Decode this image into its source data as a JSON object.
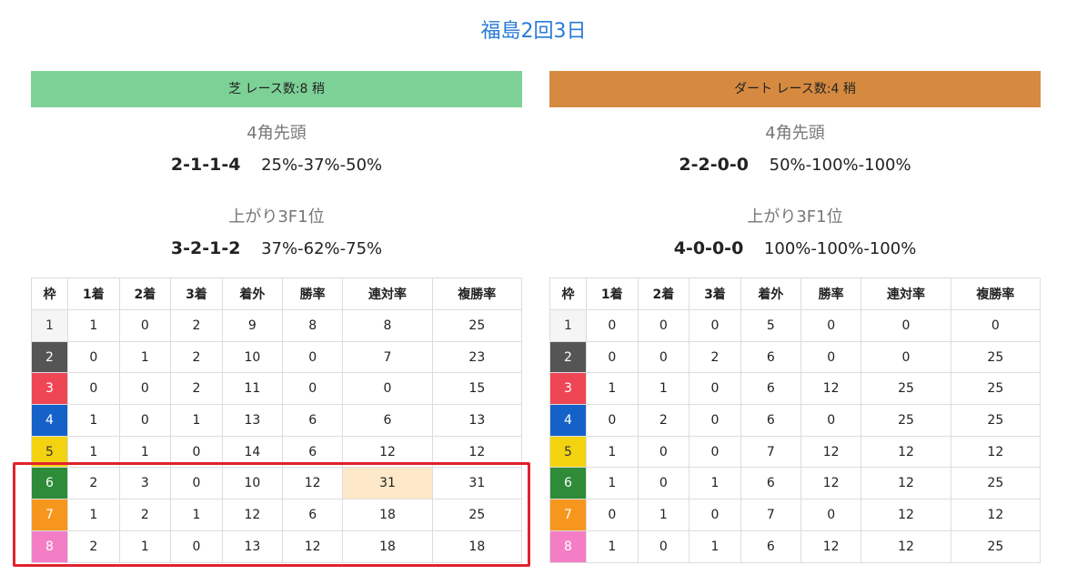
{
  "title": "福島2回3日",
  "colors": {
    "turf_header": "#7dd197",
    "dirt_header": "#d68a40",
    "highlight_cell": "#fde9c9",
    "highlight_box": "#e0232d",
    "frames": [
      "#f5f5f5",
      "#555555",
      "#ef4655",
      "#1462c8",
      "#f3d30f",
      "#2e8b38",
      "#f7961d",
      "#f47ec6"
    ],
    "frame_text": [
      "#333333",
      "#ffffff",
      "#ffffff",
      "#ffffff",
      "#333333",
      "#ffffff",
      "#ffffff",
      "#ffffff"
    ]
  },
  "panels": [
    {
      "header": "芝 レース数:8  稍",
      "corner_label": "4角先頭",
      "corner_big": [
        "2",
        "1",
        "1",
        "4"
      ],
      "corner_pct": "25%-37%-50%",
      "agari_label": "上がり3F1位",
      "agari_big": [
        "3",
        "2",
        "1",
        "2"
      ],
      "agari_pct": "37%-62%-75%",
      "columns": [
        "枠",
        "1着",
        "2着",
        "3着",
        "着外",
        "勝率",
        "連対率",
        "複勝率"
      ],
      "rows": [
        [
          "1",
          "1",
          "0",
          "2",
          "9",
          "8",
          "8",
          "25"
        ],
        [
          "2",
          "0",
          "1",
          "2",
          "10",
          "0",
          "7",
          "23"
        ],
        [
          "3",
          "0",
          "0",
          "2",
          "11",
          "0",
          "0",
          "15"
        ],
        [
          "4",
          "1",
          "0",
          "1",
          "13",
          "6",
          "6",
          "13"
        ],
        [
          "5",
          "1",
          "1",
          "0",
          "14",
          "6",
          "12",
          "12"
        ],
        [
          "6",
          "2",
          "3",
          "0",
          "10",
          "12",
          "31",
          "31"
        ],
        [
          "7",
          "1",
          "2",
          "1",
          "12",
          "6",
          "18",
          "25"
        ],
        [
          "8",
          "2",
          "1",
          "0",
          "13",
          "12",
          "18",
          "18"
        ]
      ]
    },
    {
      "header": "ダート レース数:4  稍",
      "corner_label": "4角先頭",
      "corner_big": [
        "2",
        "2",
        "0",
        "0"
      ],
      "corner_pct": "50%-100%-100%",
      "agari_label": "上がり3F1位",
      "agari_big": [
        "4",
        "0",
        "0",
        "0"
      ],
      "agari_pct": "100%-100%-100%",
      "columns": [
        "枠",
        "1着",
        "2着",
        "3着",
        "着外",
        "勝率",
        "連対率",
        "複勝率"
      ],
      "rows": [
        [
          "1",
          "0",
          "0",
          "0",
          "5",
          "0",
          "0",
          "0"
        ],
        [
          "2",
          "0",
          "0",
          "2",
          "6",
          "0",
          "0",
          "25"
        ],
        [
          "3",
          "1",
          "1",
          "0",
          "6",
          "12",
          "25",
          "25"
        ],
        [
          "4",
          "0",
          "2",
          "0",
          "6",
          "0",
          "25",
          "25"
        ],
        [
          "5",
          "1",
          "0",
          "0",
          "7",
          "12",
          "12",
          "12"
        ],
        [
          "6",
          "1",
          "0",
          "1",
          "6",
          "12",
          "12",
          "25"
        ],
        [
          "7",
          "0",
          "1",
          "0",
          "7",
          "0",
          "12",
          "12"
        ],
        [
          "8",
          "1",
          "0",
          "1",
          "6",
          "12",
          "12",
          "25"
        ]
      ]
    }
  ]
}
